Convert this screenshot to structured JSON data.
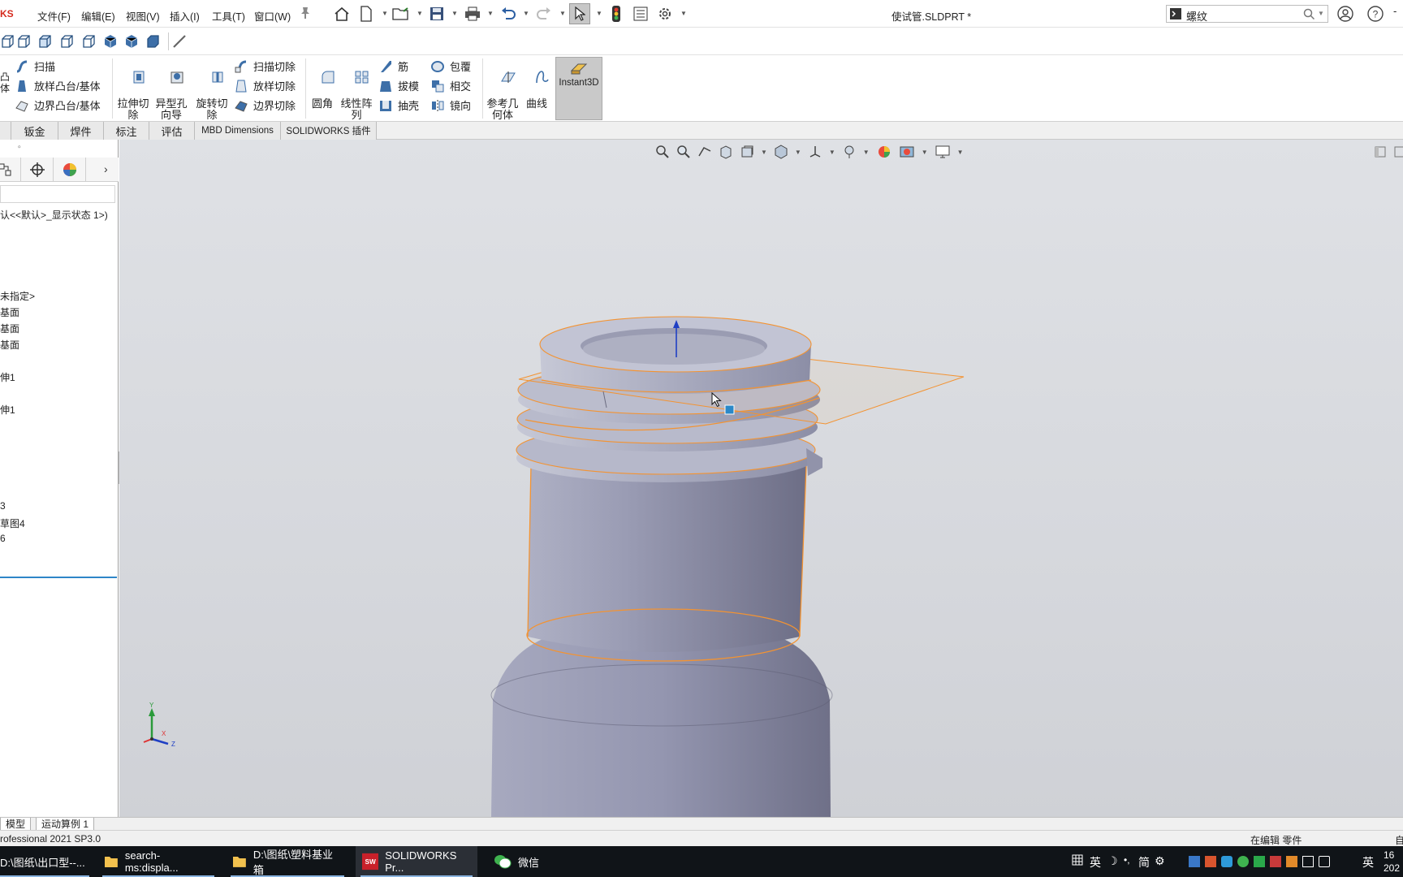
{
  "app": {
    "brand": "KS",
    "doc_title": "使试管.SLDPRT *"
  },
  "menu": [
    "文件(F)",
    "编辑(E)",
    "视图(V)",
    "插入(I)",
    "工具(T)",
    "窗口(W)"
  ],
  "search": {
    "value": "螺纹"
  },
  "features": {
    "col1": [
      "扫描",
      "放样凸台/基体",
      "边界凸台/基体"
    ],
    "col1_cut_label": "凸\n体",
    "big1": [
      "拉伸切\n除",
      "异型孔\n向导",
      "旋转切\n除"
    ],
    "col2": [
      "扫描切除",
      "放样切除",
      "边界切除"
    ],
    "big2": [
      "圆角",
      "线性阵\n列"
    ],
    "col3": [
      "筋",
      "拔模",
      "抽壳"
    ],
    "col4": [
      "包覆",
      "相交",
      "镜向"
    ],
    "big3": [
      "参考几\n何体",
      "曲线"
    ],
    "instant3d": "Instant3D"
  },
  "tabs": [
    "钣金",
    "焊件",
    "标注",
    "评估",
    "MBD Dimensions",
    "SOLIDWORKS 插件"
  ],
  "tree": {
    "config": "认<<默认>_显示状态 1>)",
    "items": [
      "未指定>",
      "基面",
      "基面",
      "基面",
      "伸1",
      "伸1",
      "3",
      "草图4",
      "6"
    ]
  },
  "model_tabs": [
    "模型",
    "运动算例 1"
  ],
  "status": {
    "left": "rofessional 2021 SP3.0",
    "mode": "在编辑 零件",
    "right": "自"
  },
  "taskbar": {
    "items": [
      "D:\\图纸\\出口型--...",
      "search-ms:displa...",
      "D:\\图纸\\塑料基业箱",
      "SOLIDWORKS Pr...",
      "微信"
    ],
    "tray": [
      "英",
      "简",
      "英"
    ],
    "clock_a": "16",
    "clock_b": "202"
  },
  "triad": {
    "y": "Y",
    "x": "X",
    "z": "Z"
  },
  "colors": {
    "accent_orange": "#f39332",
    "model_body": "#8e90a6",
    "selection_blue": "#2a88c8"
  }
}
